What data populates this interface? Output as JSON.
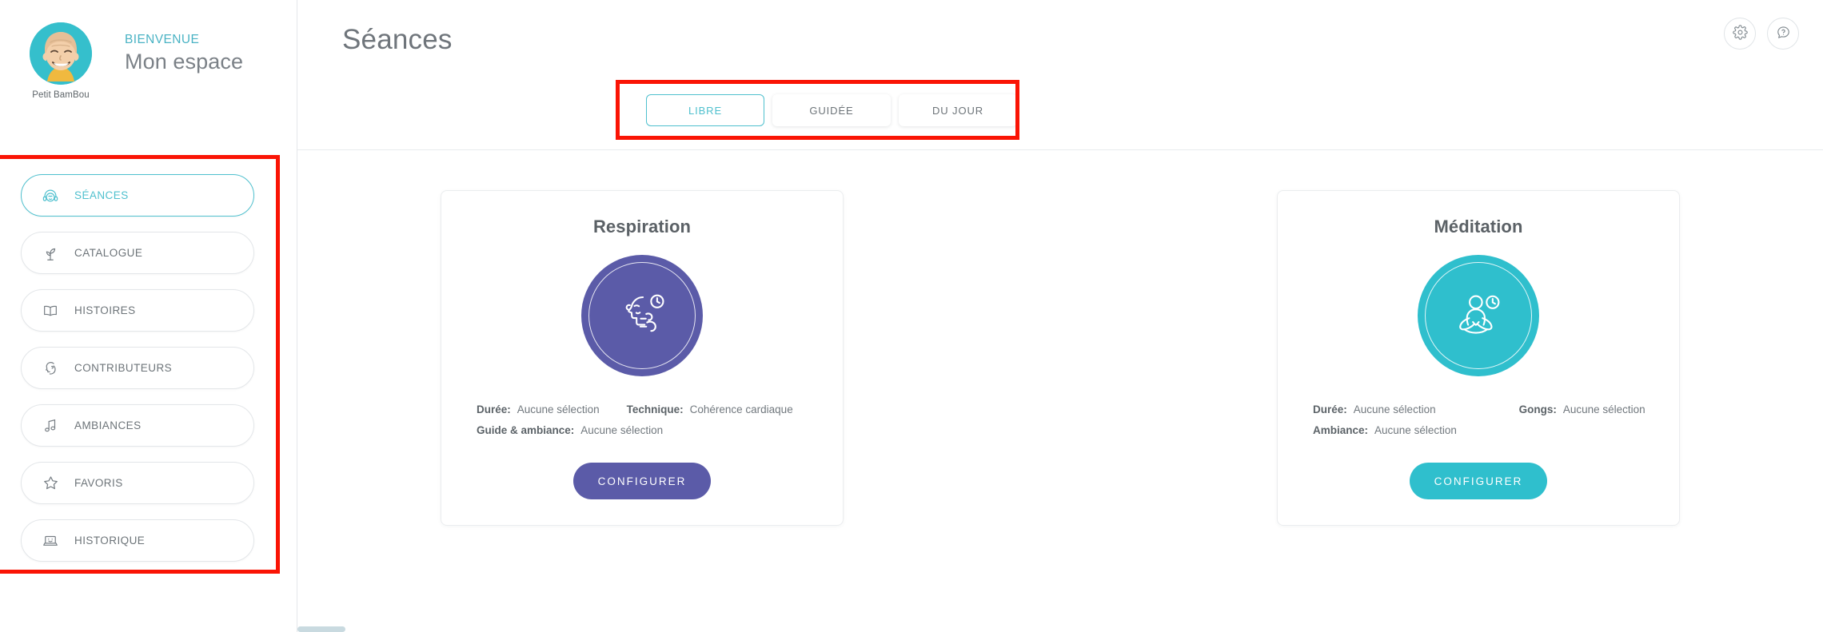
{
  "colors": {
    "teal": "#35bfcc",
    "teal_border": "#4fc0ce",
    "purple": "#5b5ba8",
    "text_gray": "#6d7479",
    "highlight_red": "#fa1405"
  },
  "sidebar": {
    "profile": {
      "avatar_name": "Petit BamBou",
      "kicker": "BIENVENUE",
      "title": "Mon espace"
    },
    "items": [
      {
        "label": "SÉANCES",
        "icon": "headphones-icon",
        "active": true
      },
      {
        "label": "CATALOGUE",
        "icon": "plant-icon",
        "active": false
      },
      {
        "label": "HISTOIRES",
        "icon": "book-icon",
        "active": false
      },
      {
        "label": "CONTRIBUTEURS",
        "icon": "head-speech-icon",
        "active": false
      },
      {
        "label": "AMBIANCES",
        "icon": "music-note-icon",
        "active": false
      },
      {
        "label": "FAVORIS",
        "icon": "star-icon",
        "active": false
      },
      {
        "label": "HISTORIQUE",
        "icon": "laptop-icon",
        "active": false
      }
    ]
  },
  "header": {
    "title": "Séances",
    "tabs": [
      {
        "label": "LIBRE",
        "active": true
      },
      {
        "label": "GUIDÉE",
        "active": false
      },
      {
        "label": "DU JOUR",
        "active": false
      }
    ],
    "actions": [
      {
        "name": "settings-button",
        "icon": "gear-icon"
      },
      {
        "name": "help-button",
        "icon": "help-icon"
      }
    ]
  },
  "cards": [
    {
      "title": "Respiration",
      "icon": "breathing-face-clock-icon",
      "accent": "#5b5ba8",
      "meta": [
        [
          {
            "key": "Durée:",
            "value": "Aucune sélection"
          },
          {
            "key": "Technique:",
            "value": "Cohérence cardiaque"
          }
        ],
        [
          {
            "key": "Guide & ambiance:",
            "value": "Aucune sélection"
          }
        ]
      ],
      "cta": "CONFIGURER"
    },
    {
      "title": "Méditation",
      "icon": "lotus-clock-icon",
      "accent": "#2fbfcd",
      "meta": [
        [
          {
            "key": "Durée:",
            "value": "Aucune sélection"
          },
          {
            "key": "Gongs:",
            "value": "Aucune sélection"
          }
        ],
        [
          {
            "key": "Ambiance:",
            "value": "Aucune sélection"
          }
        ]
      ],
      "cta": "CONFIGURER"
    }
  ]
}
